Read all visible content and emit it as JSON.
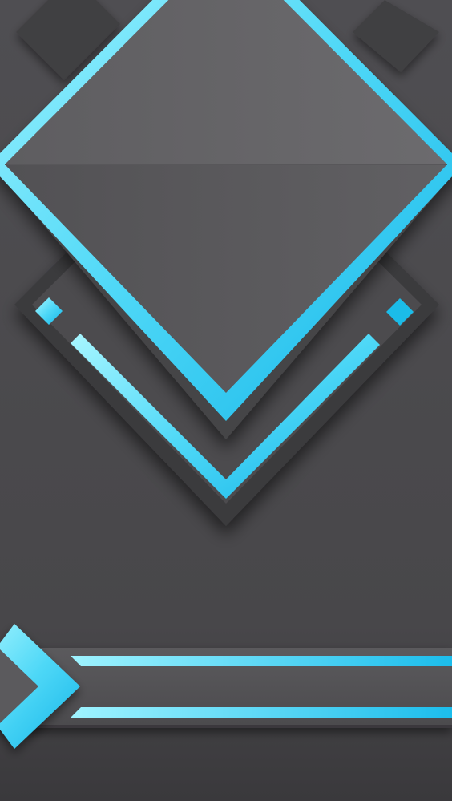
{
  "wallpaper": {
    "style": "abstract geometric diamonds",
    "colors": {
      "background": "#4a494c",
      "background_dark": "#2f2e31",
      "panel_gray": "#5d5c5f",
      "panel_gray_light": "#6b6a6d",
      "panel_gray_dark": "#3d3c3f",
      "accent_cyan": "#1ec3f0",
      "accent_cyan_light": "#8cf0ff"
    }
  }
}
